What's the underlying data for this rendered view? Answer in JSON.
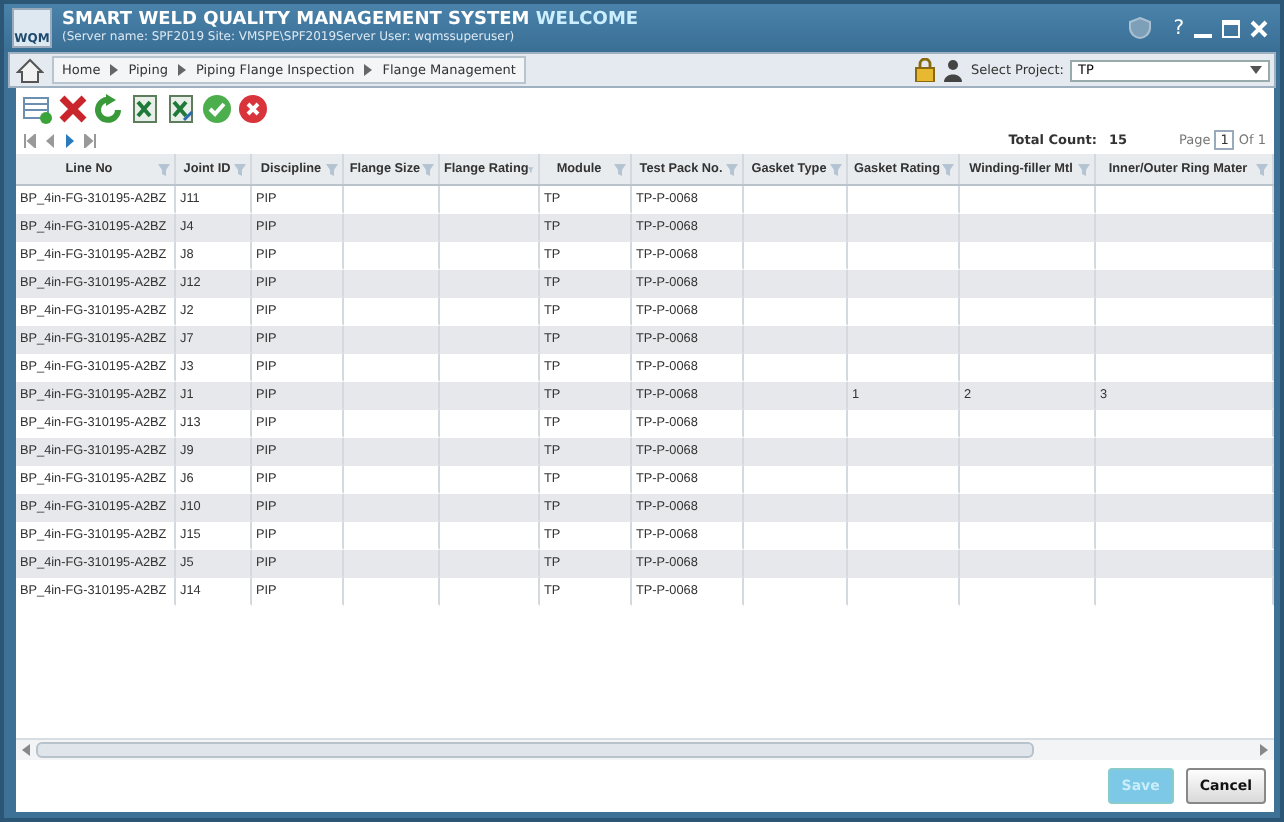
{
  "window": {
    "logo_text": "WQM",
    "title": "SMART WELD QUALITY MANAGEMENT SYSTEM",
    "welcome": "WELCOME",
    "subtitle": "(Server name: SPF2019 Site: VMSPE\\SPF2019Server User: wqmssuperuser)",
    "help": "?"
  },
  "breadcrumb": [
    "Home",
    "Piping",
    "Piping Flange Inspection",
    "Flange Management"
  ],
  "project": {
    "label": "Select Project:",
    "value": "TP"
  },
  "pager": {
    "total_label": "Total Count:",
    "total": "15",
    "page_label": "Page",
    "page": "1",
    "of": "Of 1"
  },
  "table": {
    "columns": [
      "Line No",
      "Joint ID",
      "Discipline",
      "Flange Size",
      "Flange Rating",
      "Module",
      "Test Pack No.",
      "Gasket Type",
      "Gasket Rating",
      "Winding-filler Mtl",
      "Inner/Outer Ring Mater"
    ],
    "rows": [
      {
        "line_no": "BP_4in-FG-310195-A2BZ",
        "joint_id": "J11",
        "discipline": "PIP",
        "module": "TP",
        "test_pack": "TP-P-0068"
      },
      {
        "line_no": "BP_4in-FG-310195-A2BZ",
        "joint_id": "J4",
        "discipline": "PIP",
        "module": "TP",
        "test_pack": "TP-P-0068"
      },
      {
        "line_no": "BP_4in-FG-310195-A2BZ",
        "joint_id": "J8",
        "discipline": "PIP",
        "module": "TP",
        "test_pack": "TP-P-0068"
      },
      {
        "line_no": "BP_4in-FG-310195-A2BZ",
        "joint_id": "J12",
        "discipline": "PIP",
        "module": "TP",
        "test_pack": "TP-P-0068"
      },
      {
        "line_no": "BP_4in-FG-310195-A2BZ",
        "joint_id": "J2",
        "discipline": "PIP",
        "module": "TP",
        "test_pack": "TP-P-0068"
      },
      {
        "line_no": "BP_4in-FG-310195-A2BZ",
        "joint_id": "J7",
        "discipline": "PIP",
        "module": "TP",
        "test_pack": "TP-P-0068"
      },
      {
        "line_no": "BP_4in-FG-310195-A2BZ",
        "joint_id": "J3",
        "discipline": "PIP",
        "module": "TP",
        "test_pack": "TP-P-0068"
      },
      {
        "line_no": "BP_4in-FG-310195-A2BZ",
        "joint_id": "J1",
        "discipline": "PIP",
        "module": "TP",
        "test_pack": "TP-P-0068",
        "gasket_rating": "1",
        "winding_filler": "2",
        "inner_outer_ring": "3"
      },
      {
        "line_no": "BP_4in-FG-310195-A2BZ",
        "joint_id": "J13",
        "discipline": "PIP",
        "module": "TP",
        "test_pack": "TP-P-0068"
      },
      {
        "line_no": "BP_4in-FG-310195-A2BZ",
        "joint_id": "J9",
        "discipline": "PIP",
        "module": "TP",
        "test_pack": "TP-P-0068"
      },
      {
        "line_no": "BP_4in-FG-310195-A2BZ",
        "joint_id": "J6",
        "discipline": "PIP",
        "module": "TP",
        "test_pack": "TP-P-0068"
      },
      {
        "line_no": "BP_4in-FG-310195-A2BZ",
        "joint_id": "J10",
        "discipline": "PIP",
        "module": "TP",
        "test_pack": "TP-P-0068"
      },
      {
        "line_no": "BP_4in-FG-310195-A2BZ",
        "joint_id": "J15",
        "discipline": "PIP",
        "module": "TP",
        "test_pack": "TP-P-0068"
      },
      {
        "line_no": "BP_4in-FG-310195-A2BZ",
        "joint_id": "J5",
        "discipline": "PIP",
        "module": "TP",
        "test_pack": "TP-P-0068"
      },
      {
        "line_no": "BP_4in-FG-310195-A2BZ",
        "joint_id": "J14",
        "discipline": "PIP",
        "module": "TP",
        "test_pack": "TP-P-0068"
      }
    ]
  },
  "buttons": [
    {
      "label": "Save",
      "disabled": true
    },
    {
      "label": "Cancel",
      "disabled": false
    }
  ]
}
